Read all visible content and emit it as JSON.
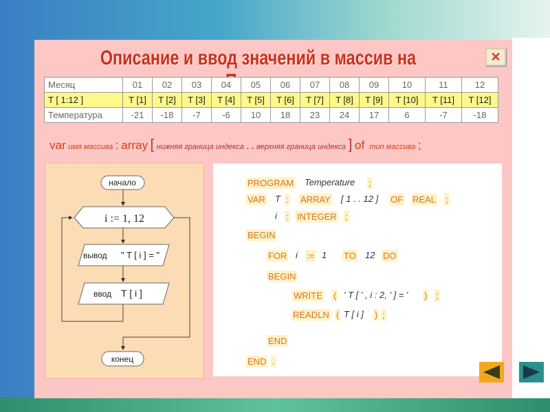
{
  "title": "Описание и ввод значений в массив на Паскале",
  "close_icon": "close-icon",
  "table": {
    "rows": [
      {
        "header": "Месяц",
        "cells": [
          "01",
          "02",
          "03",
          "04",
          "05",
          "06",
          "07",
          "08",
          "09",
          "10",
          "11",
          "12"
        ]
      },
      {
        "header": "T [ 1:12 ]",
        "cells": [
          "T [1]",
          "T [2]",
          "T [3]",
          "T [4]",
          "T [5]",
          "T [6]",
          "T [7]",
          "T [8]",
          "T [9]",
          "T [10]",
          "T [11]",
          "T [12]"
        ]
      },
      {
        "header": "Температура",
        "cells": [
          "-21",
          "-18",
          "-7",
          "-6",
          "10",
          "18",
          "23",
          "24",
          "17",
          "6",
          "-7",
          "-18"
        ]
      }
    ]
  },
  "syntax": {
    "var": "var",
    "name": "имя массива",
    "colon": ":",
    "array": "array",
    "lb": "[",
    "low": "нижняя граница индекса",
    "dots": ". .",
    "high": "верхняя граница индекса",
    "rb": "]",
    "of": "of",
    "type": "тип массива",
    "semi": ";"
  },
  "flowchart": {
    "start": "начало",
    "loop": "i := 1, 12",
    "output": "вывод",
    "output_text": "\" T [ i ] = \"",
    "input": "ввод",
    "input_text": "T [ i ]",
    "end": "конец"
  },
  "code": {
    "l1": [
      "PROGRAM",
      "Temperature",
      ";"
    ],
    "l2": [
      "VAR",
      "T",
      ":",
      "ARRAY",
      "[ 1 . . 12 ]",
      "OF",
      "REAL",
      ";"
    ],
    "l3": [
      "i",
      ":",
      "INTEGER",
      ";"
    ],
    "l4": [
      "BEGIN"
    ],
    "l5": [
      "FOR",
      "i",
      ":=",
      "1",
      "TO",
      "12",
      "DO"
    ],
    "l6": [
      "BEGIN"
    ],
    "l7": [
      "WRITE",
      "(",
      "' T [ ' , i : 2, ' ] = '",
      ")",
      ";"
    ],
    "l8": [
      "READLN",
      "(",
      "T [ i ]",
      ")",
      ";"
    ],
    "l9": [
      "END"
    ],
    "l10": [
      "END",
      "."
    ]
  },
  "nav": {
    "prev_icon": "triangle-left-icon",
    "next_icon": "triangle-right-icon",
    "prev_color": "#f2a81c",
    "next_color": "#2a8f8f"
  }
}
